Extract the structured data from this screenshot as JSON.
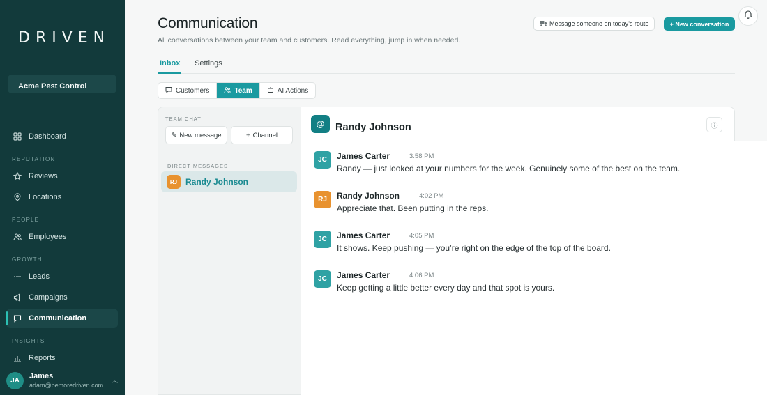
{
  "sidebar": {
    "logo": "DRIVEN",
    "org": "Acme Pest Control",
    "items": [
      {
        "label": "Dashboard",
        "icon": "dashboard-icon"
      },
      {
        "section": "REPUTATION"
      },
      {
        "label": "Reviews",
        "icon": "star-icon"
      },
      {
        "label": "Locations",
        "icon": "location-pin-icon"
      },
      {
        "section": "PEOPLE"
      },
      {
        "label": "Employees",
        "icon": "users-icon"
      },
      {
        "section": "GROWTH"
      },
      {
        "label": "Leads",
        "icon": "list-icon"
      },
      {
        "label": "Campaigns",
        "icon": "megaphone-icon"
      },
      {
        "label": "Communication",
        "icon": "chat-icon",
        "active": true
      },
      {
        "section": "INSIGHTS"
      },
      {
        "label": "Reports",
        "icon": "bar-chart-icon"
      }
    ],
    "user": {
      "initials": "JA",
      "name": "James",
      "email": "adam@bemoredriven.com"
    }
  },
  "header": {
    "title": "Communication",
    "subtitle": "All conversations between your team and customers. Read everything, jump in when needed.",
    "route_button": "Message someone on today’s route",
    "new_button": "+ New conversation"
  },
  "tabs": [
    {
      "label": "Inbox",
      "active": true
    },
    {
      "label": "Settings"
    }
  ],
  "segments": [
    {
      "label": "Customers"
    },
    {
      "label": "Team",
      "active": true
    },
    {
      "label": "AI Actions"
    }
  ],
  "list": {
    "team_chat_label": "TEAM CHAT",
    "new_message": "New message",
    "channel": "Channel",
    "dm_label": "DIRECT MESSAGES",
    "dm": {
      "initials": "RJ",
      "name": "Randy Johnson"
    }
  },
  "conversation": {
    "name": "Randy Johnson",
    "messages": [
      {
        "initials": "JC",
        "sender": "James Carter",
        "time": "3:58 PM",
        "text": "Randy — just looked at your numbers for the week. Genuinely some of the best on the team.",
        "color": "#2fa2a4"
      },
      {
        "initials": "RJ",
        "sender": "Randy Johnson",
        "time": "4:02 PM",
        "text": "Appreciate that. Been putting in the reps.",
        "color": "#e8922f"
      },
      {
        "initials": "JC",
        "sender": "James Carter",
        "time": "4:05 PM",
        "text": "It shows. Keep pushing — you’re right on the edge of the top of the board.",
        "color": "#2fa2a4"
      },
      {
        "initials": "JC",
        "sender": "James Carter",
        "time": "4:06 PM",
        "text": "Keep getting a little better every day and that spot is yours.",
        "color": "#2fa2a4"
      }
    ]
  },
  "colors": {
    "sidebar": "#123a3b",
    "accent": "#1a9aa0"
  }
}
